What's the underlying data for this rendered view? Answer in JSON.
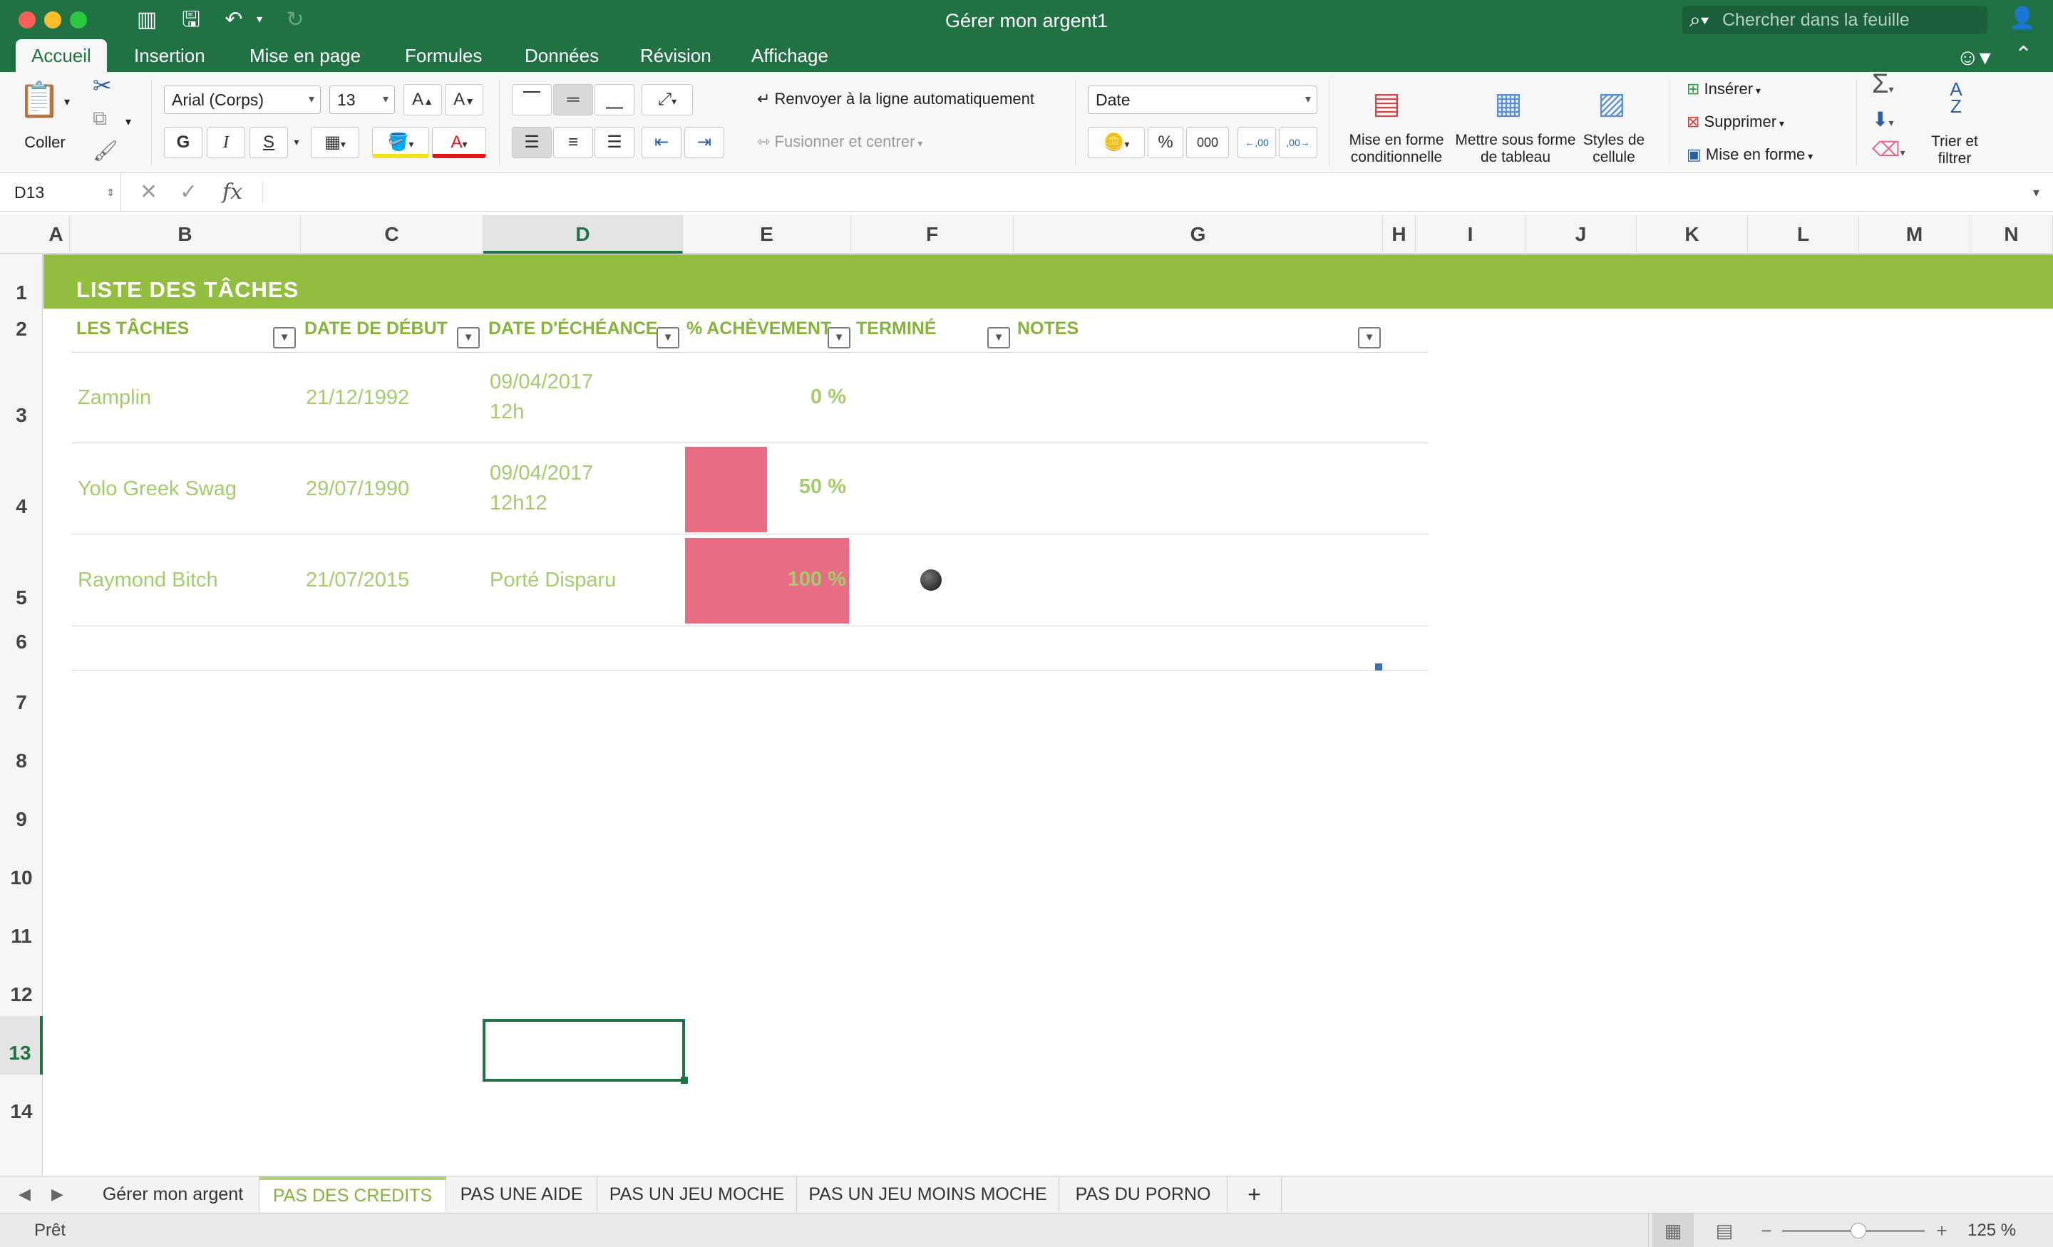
{
  "window": {
    "title": "Gérer mon argent1"
  },
  "search": {
    "placeholder": "Chercher dans la feuille"
  },
  "ribbon_tabs": [
    "Accueil",
    "Insertion",
    "Mise en page",
    "Formules",
    "Données",
    "Révision",
    "Affichage"
  ],
  "active_tab": "Accueil",
  "ribbon": {
    "paste_label": "Coller",
    "font_name": "Arial (Corps)",
    "font_size": "13",
    "bold": "G",
    "italic": "I",
    "underline": "S",
    "wrap_text": "Renvoyer à la ligne automatiquement",
    "merge_center": "Fusionner et centrer",
    "number_format": "Date",
    "percent": "%",
    "thousands": "000",
    "conditional_format": "Mise en forme conditionnelle",
    "format_as_table": "Mettre sous forme de tableau",
    "cell_styles": "Styles de cellule",
    "insert": "Insérer",
    "delete": "Supprimer",
    "format": "Mise en forme",
    "sort_filter": "Trier et filtrer",
    "sort_az": "A",
    "sort_za": "Z"
  },
  "formula_bar": {
    "name_box": "D13",
    "fx": "fx"
  },
  "columns": [
    "A",
    "B",
    "C",
    "D",
    "E",
    "F",
    "G",
    "H",
    "I",
    "J",
    "K",
    "L",
    "M",
    "N"
  ],
  "selected_column": "D",
  "rows": [
    "1",
    "2",
    "3",
    "4",
    "5",
    "6",
    "7",
    "8",
    "9",
    "10",
    "11",
    "12",
    "13",
    "14"
  ],
  "selected_row": "13",
  "sheet": {
    "title": "LISTE DES TÂCHES",
    "headers": [
      "LES TÂCHES",
      "DATE DE DÉBUT",
      "DATE D'ÉCHÉANCE",
      "% ACHÈVEMENT",
      "TERMINÉ",
      "NOTES"
    ],
    "tasks": [
      {
        "task": "Zamplin",
        "start": "21/12/1992",
        "due_line1": "09/04/2017",
        "due_line2": "12h",
        "percent_label": "0 %",
        "percent": 0,
        "done": false
      },
      {
        "task": "Yolo Greek Swag",
        "start": "29/07/1990",
        "due_line1": "09/04/2017",
        "due_line2": "12h12",
        "percent_label": "50 %",
        "percent": 50,
        "done": false
      },
      {
        "task": "Raymond Bitch",
        "start": "21/07/2015",
        "due_line1": "Porté Disparu",
        "due_line2": "",
        "percent_label": "100 %",
        "percent": 100,
        "done": true
      }
    ]
  },
  "sheet_tabs": [
    "Gérer mon argent",
    "PAS DES CREDITS",
    "PAS UNE AIDE",
    "PAS UN JEU MOCHE",
    "PAS UN JEU MOINS MOCHE",
    "PAS DU PORNO"
  ],
  "active_sheet": "PAS DES CREDITS",
  "add_sheet": "+",
  "status": {
    "text": "Prêt",
    "zoom": "125 %",
    "zoom_minus": "−",
    "zoom_plus": "+"
  },
  "colors": {
    "accent": "#217346",
    "band": "#92bd3e",
    "header_text": "#86b43a",
    "cell_text": "#a5cc6b",
    "bar": "#e96c85"
  }
}
